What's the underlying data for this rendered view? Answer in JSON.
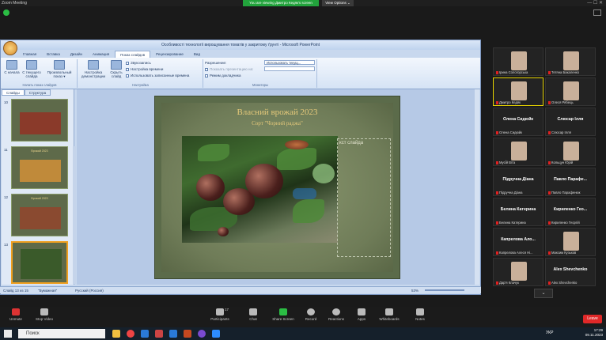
{
  "zoom": {
    "app_title": "Zoom Meeting",
    "viewing_banner": "You are viewing Дмитро Кедяк's screen",
    "view_options": "View Options ⌄",
    "window_controls": "—  ☐  ✕"
  },
  "ppt": {
    "title": "Особливості технології вирощування томатів у закритому ґрунті  -  Microsoft PowerPoint",
    "tabs": [
      "Главная",
      "Вставка",
      "Дизайн",
      "Анимация",
      "Показ слайдов",
      "Рецензирование",
      "Вид"
    ],
    "active_tab": "Показ слайдов",
    "ribbon": {
      "btn_start": "С начала",
      "btn_current": "С текущего слайда",
      "btn_custom": "Произвольный показ ▾",
      "group_start": "Начать показ слайдов",
      "btn_setup": "Настройка демонстрации",
      "btn_hide": "Скрыть слайд",
      "opt_record": "Звукозапись",
      "opt_timing": "Настройка времени",
      "opt_use_timing": "Использовать записанные времена",
      "group_setup": "Настройка",
      "resolution_label": "Разрешение:",
      "resolution_value": "Использовать текущ...",
      "show_on_label": "Показать презентацию на:",
      "presenter_view": "Режим докладчика",
      "group_monitors": "Мониторы"
    },
    "pane_tabs": [
      "Слайды",
      "Структура"
    ],
    "slide_numbers": [
      "10",
      "11",
      "12",
      "13"
    ],
    "thumb_titles": [
      "",
      "Врожай 2023",
      "Врожай 2023",
      ""
    ],
    "slide": {
      "title": "Власний врожай 2023",
      "subtitle": "Сорт \"Чорний раджа\"",
      "text_placeholder": "кст слайда"
    },
    "status": {
      "slide_info": "Слайд 13 из 15",
      "theme": "\"Бумажная\"",
      "language": "Русский (Россия)",
      "zoom": "53%"
    }
  },
  "participants": [
    {
      "name": "Ірина Сологорська",
      "type": "video"
    },
    {
      "name": "Тетяна Бакаленко",
      "type": "video"
    },
    {
      "name": "Дмитро Кедяк",
      "type": "video",
      "active": true
    },
    {
      "name": "Олеся Рябець",
      "type": "video"
    },
    {
      "display": "Олена Сидюйк",
      "name": "Олена Сидюйк",
      "type": "name"
    },
    {
      "display": "Слюсар Ілля",
      "name": "Слюсар Ілля",
      "type": "name"
    },
    {
      "name": "Мусі́й Віта",
      "type": "video"
    },
    {
      "name": "Кольцун Юрій",
      "type": "video"
    },
    {
      "display": "Підручна Діана",
      "name": "Підручна Діана",
      "type": "name"
    },
    {
      "display": "Павло Парафе...",
      "name": "Павло Парафенюк",
      "type": "name"
    },
    {
      "display": "Белина Катерина",
      "name": "Белина Катерина",
      "type": "name"
    },
    {
      "display": "Кириленко Гео...",
      "name": "Кириленко Георгій",
      "type": "name"
    },
    {
      "display": "Капрелова Ало...",
      "name": "Капрелова Алеся Ні...",
      "type": "name"
    },
    {
      "name": "Максим Кузьков",
      "type": "video"
    },
    {
      "name": "Дар'я Клачук",
      "type": "video"
    },
    {
      "display": "Alex Shevchenko",
      "name": "Alex Shevchenko",
      "type": "name"
    }
  ],
  "toolbar": {
    "unmute": "Unmute",
    "stop_video": "Stop Video",
    "participants": "Participants",
    "participants_count": "17",
    "chat": "Chat",
    "share": "Share Screen",
    "record": "Record",
    "reactions": "Reactions",
    "apps": "Apps",
    "whiteboards": "Whiteboards",
    "notes": "Notes",
    "leave": "Leave"
  },
  "taskbar": {
    "search_placeholder": "Поиск",
    "lang": "УКР",
    "time": "17:29",
    "date": "09.11.2023"
  }
}
